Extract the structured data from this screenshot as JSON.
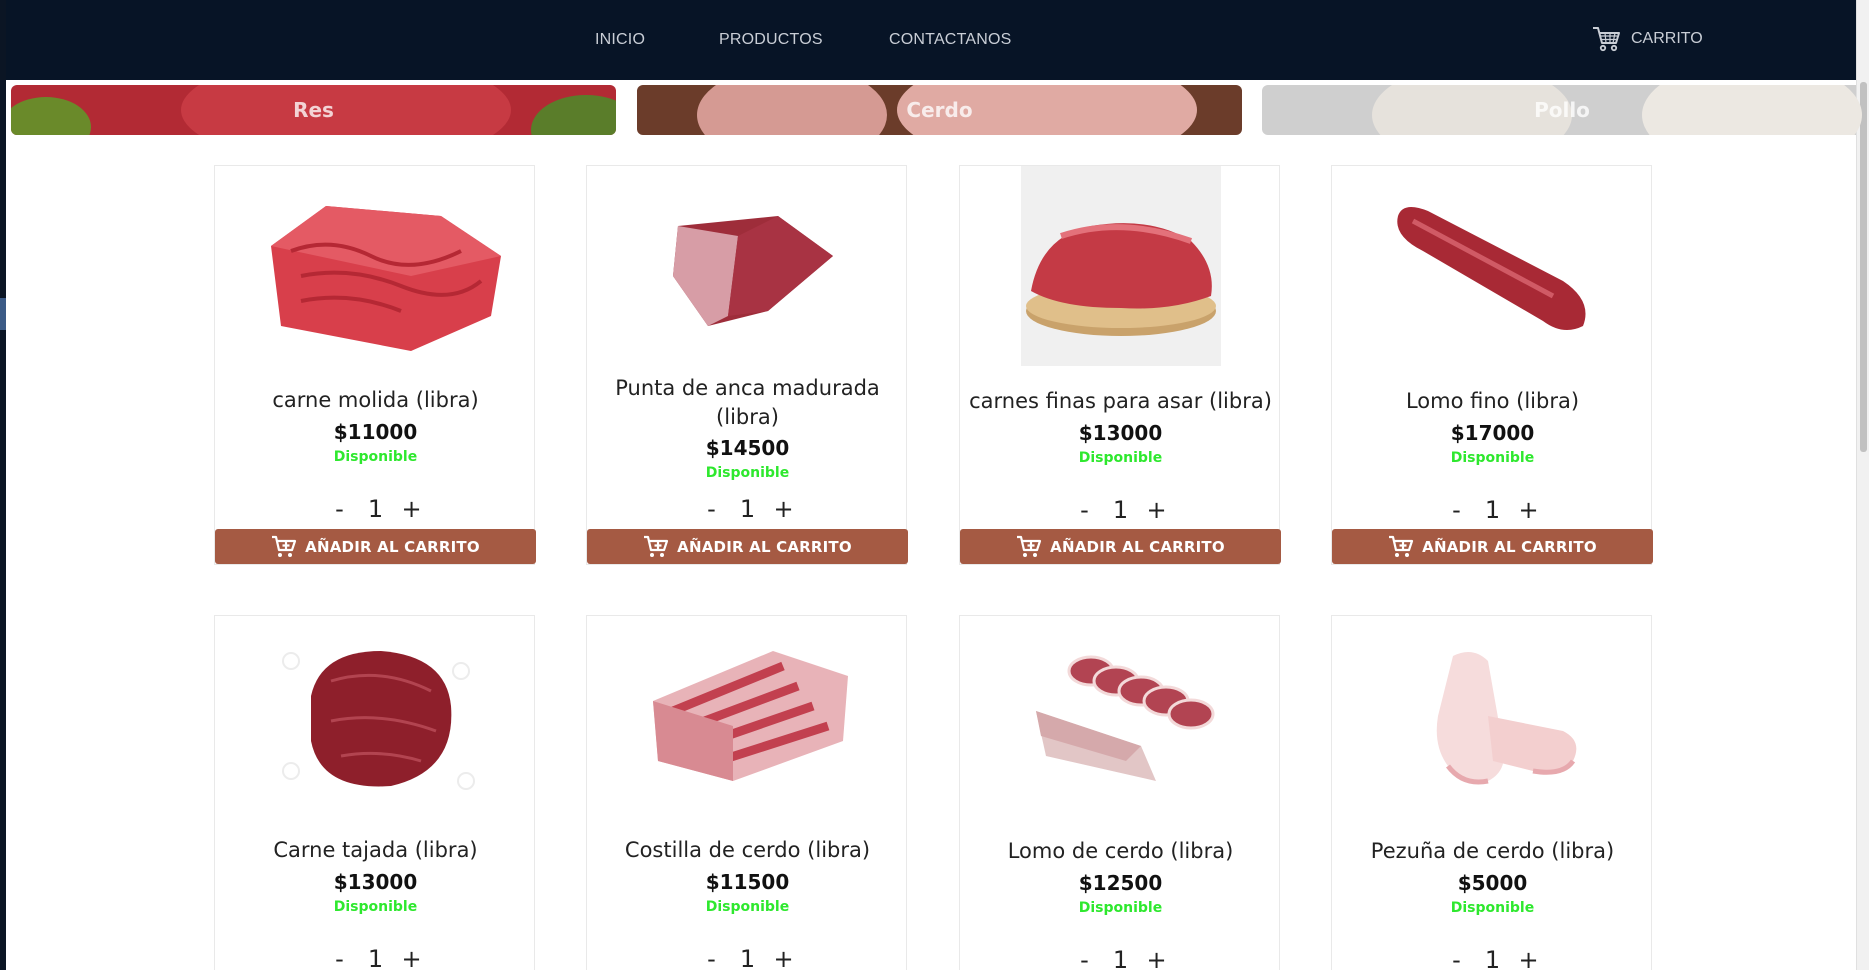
{
  "nav": {
    "links": [
      "INICIO",
      "PRODUCTOS",
      "CONTACTANOS"
    ],
    "cart_label": "CARRITO"
  },
  "categories": [
    {
      "label": "Res",
      "color": "#b22a34"
    },
    {
      "label": "Cerdo",
      "color": "#7a4432"
    },
    {
      "label": "Pollo",
      "color": "#cfcfcf"
    }
  ],
  "products": [
    {
      "name": "carne molida (libra)",
      "price": "$11000",
      "status": "Disponible",
      "quantity": "1"
    },
    {
      "name": "Punta de anca madurada (libra)",
      "price": "$14500",
      "status": "Disponible",
      "quantity": "1"
    },
    {
      "name": "carnes finas para asar (libra)",
      "price": "$13000",
      "status": "Disponible",
      "quantity": "1"
    },
    {
      "name": "Lomo fino (libra)",
      "price": "$17000",
      "status": "Disponible",
      "quantity": "1"
    },
    {
      "name": "Carne tajada (libra)",
      "price": "$13000",
      "status": "Disponible",
      "quantity": "1"
    },
    {
      "name": "Costilla de cerdo (libra)",
      "price": "$11500",
      "status": "Disponible",
      "quantity": "1"
    },
    {
      "name": "Lomo de cerdo (libra)",
      "price": "$12500",
      "status": "Disponible",
      "quantity": "1"
    },
    {
      "name": "Pezuña de cerdo (libra)",
      "price": "$5000",
      "status": "Disponible",
      "quantity": "1"
    }
  ],
  "controls": {
    "minus": "-",
    "plus": "+",
    "add_to_cart": "AÑADIR AL CARRITO"
  },
  "colors": {
    "navbar": "#071426",
    "add_button": "#a55a43",
    "available": "#2ee82e"
  }
}
